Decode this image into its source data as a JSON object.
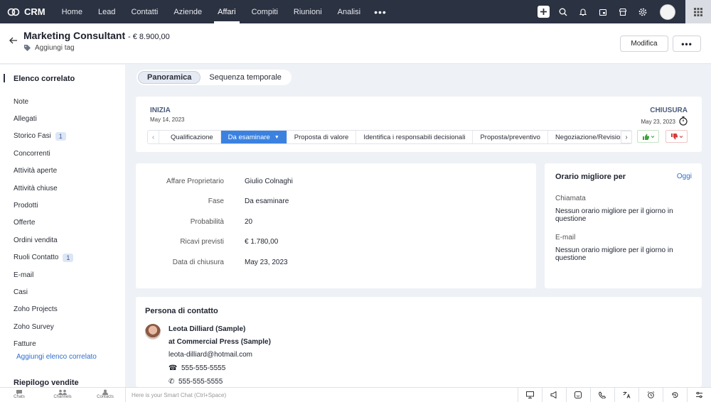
{
  "app": {
    "brand": "CRM"
  },
  "nav": {
    "items": [
      "Home",
      "Lead",
      "Contatti",
      "Aziende",
      "Affari",
      "Compiti",
      "Riunioni",
      "Analisi"
    ],
    "active": "Affari",
    "more": "•••"
  },
  "header": {
    "title": "Marketing Consultant",
    "amount": "- € 8.900,00",
    "add_tag": "Aggiungi tag",
    "edit_label": "Modifica",
    "more_label": "•••"
  },
  "sidebar": {
    "heading": "Elenco correlato",
    "items": [
      {
        "label": "Note",
        "badge": ""
      },
      {
        "label": "Allegati",
        "badge": ""
      },
      {
        "label": "Storico Fasi",
        "badge": "1"
      },
      {
        "label": "Concorrenti",
        "badge": ""
      },
      {
        "label": "Attività aperte",
        "badge": ""
      },
      {
        "label": "Attività chiuse",
        "badge": ""
      },
      {
        "label": "Prodotti",
        "badge": ""
      },
      {
        "label": "Offerte",
        "badge": ""
      },
      {
        "label": "Ordini vendita",
        "badge": ""
      },
      {
        "label": "Ruoli Contatto",
        "badge": "1"
      },
      {
        "label": "E-mail",
        "badge": ""
      },
      {
        "label": "Casi",
        "badge": ""
      },
      {
        "label": "Zoho Projects",
        "badge": ""
      },
      {
        "label": "Zoho Survey",
        "badge": ""
      },
      {
        "label": "Fatture",
        "badge": ""
      }
    ],
    "add_link": "Aggiungi elenco correlato",
    "footer_heading": "Riepilogo vendite"
  },
  "tabs": {
    "items": [
      "Panoramica",
      "Sequenza temporale"
    ],
    "active": "Panoramica"
  },
  "stage": {
    "start_label": "INIZIA",
    "start_date": "May 14, 2023",
    "end_label": "CHIUSURA",
    "end_date": "May 23, 2023",
    "stages": [
      "Qualificazione",
      "Da esaminare",
      "Proposta di valore",
      "Identifica i responsabili decisionali",
      "Proposta/preventivo",
      "Negoziazione/Revisione"
    ],
    "active_stage": "Da esaminare",
    "colors": {
      "active": "#3b82e0",
      "won": "#3aa33a",
      "lost": "#d63b3b"
    }
  },
  "details": {
    "rows": [
      {
        "label": "Affare Proprietario",
        "value": "Giulio Colnaghi"
      },
      {
        "label": "Fase",
        "value": "Da esaminare"
      },
      {
        "label": "Probabilità",
        "value": "20"
      },
      {
        "label": "Ricavi previsti",
        "value": "€ 1.780,00"
      },
      {
        "label": "Data di chiusura",
        "value": "May 23, 2023"
      }
    ]
  },
  "best_time": {
    "title": "Orario migliore per",
    "today": "Oggi",
    "call_label": "Chiamata",
    "call_value": "Nessun orario migliore per il giorno in questione",
    "email_label": "E-mail",
    "email_value": "Nessun orario migliore per il giorno in questione"
  },
  "contact": {
    "title": "Persona di contatto",
    "name": "Leota Dilliard (Sample)",
    "company": "at Commercial Press (Sample)",
    "email": "leota-dilliard@hotmail.com",
    "phone": "555-555-5555",
    "mobile": "555-555-5555"
  },
  "bottombar": {
    "items": [
      "Chats",
      "Channels",
      "Contacts"
    ],
    "smartchat_placeholder": "Here is your Smart Chat (Ctrl+Space)"
  }
}
